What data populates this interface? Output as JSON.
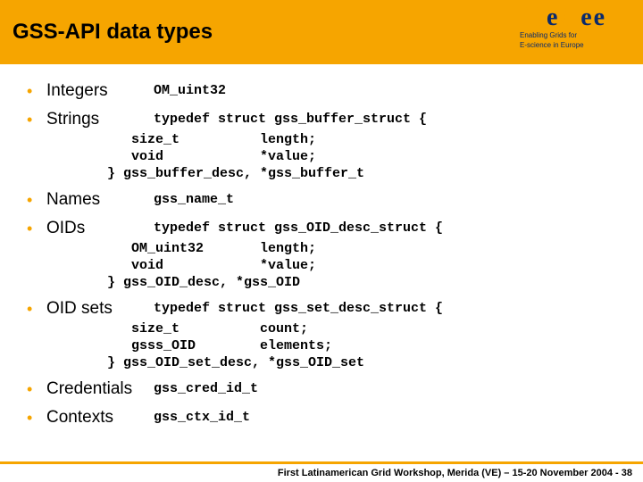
{
  "title": "GSS-API data types",
  "logo": {
    "brand": "eGee",
    "tag1": "Enabling Grids for",
    "tag2": "E-science in Europe"
  },
  "items": {
    "integers": {
      "label": "Integers",
      "code": "OM_uint32"
    },
    "strings": {
      "label": "Strings",
      "code": "typedef struct gss_buffer_struct {",
      "block": "     size_t          length;\n     void            *value;\n  } gss_buffer_desc, *gss_buffer_t"
    },
    "names": {
      "label": "Names",
      "code": "gss_name_t"
    },
    "oids": {
      "label": "OIDs",
      "code": "typedef struct gss_OID_desc_struct {",
      "block": "     OM_uint32       length;\n     void            *value;\n  } gss_OID_desc, *gss_OID"
    },
    "oidsets": {
      "label": "OID sets",
      "code": "typedef struct gss_set_desc_struct {",
      "block": "     size_t          count;\n     gsss_OID        elements;\n  } gss_OID_set_desc, *gss_OID_set"
    },
    "creds": {
      "label": "Credentials",
      "code": "gss_cred_id_t"
    },
    "ctxs": {
      "label": "Contexts",
      "code": "gss_ctx_id_t"
    }
  },
  "footer": "First Latinamerican Grid Workshop, Merida (VE) – 15-20 November 2004 - 38"
}
